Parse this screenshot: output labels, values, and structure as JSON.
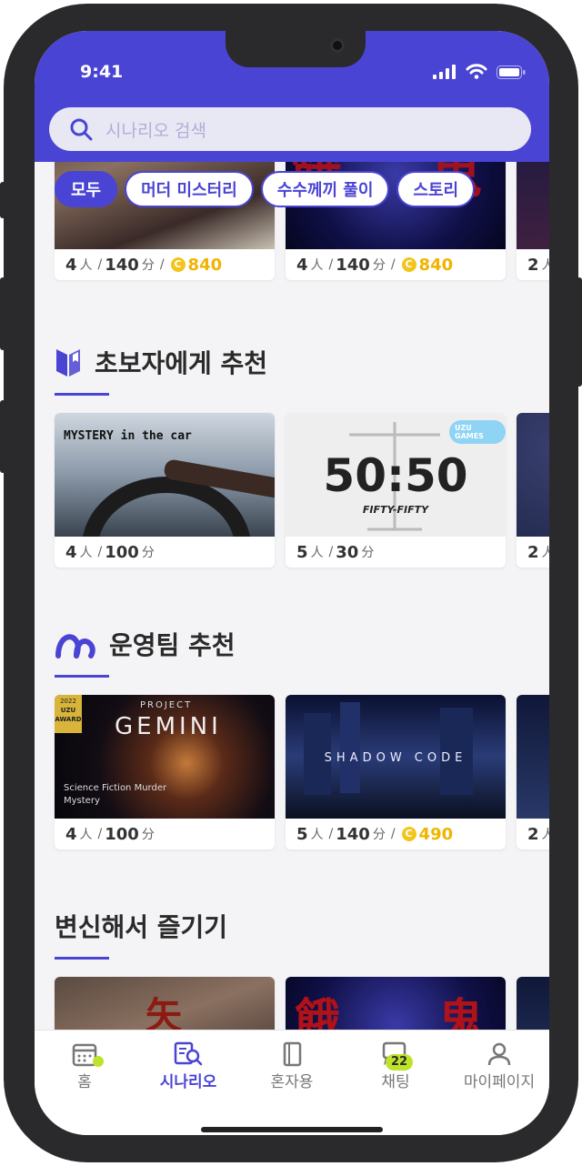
{
  "status_bar": {
    "time": "9:41"
  },
  "search": {
    "placeholder": "시나리오 검색"
  },
  "filters": [
    "모두",
    "머더 미스터리",
    "수수께끼 풀이",
    "스토리"
  ],
  "top_row": [
    {
      "players": "4",
      "players_unit": "人",
      "minutes": "140",
      "minutes_unit": "分",
      "cost": "840"
    },
    {
      "players": "4",
      "players_unit": "人",
      "minutes": "140",
      "minutes_unit": "分",
      "cost": "840"
    },
    {
      "players": "2",
      "players_unit": "人"
    }
  ],
  "sections": [
    {
      "title": "초보자에게 추천",
      "icon": "book-icon",
      "cards": [
        {
          "image_text": "MYSTERY in the car",
          "players": "4",
          "players_unit": "人",
          "minutes": "100",
          "minutes_unit": "分"
        },
        {
          "image_text": "50:50",
          "image_sub": "FIFTY-FIFTY",
          "image_logo": "UZU GAMES",
          "players": "5",
          "players_unit": "人",
          "minutes": "30",
          "minutes_unit": "分"
        },
        {
          "players": "2",
          "players_unit": "人"
        }
      ]
    },
    {
      "title": "운영팀 추천",
      "icon": "uzu-logo-icon",
      "cards": [
        {
          "image_text": "GEMINI",
          "image_pre": "PROJECT",
          "image_sub": "Science Fiction Murder Mystery",
          "image_badge": "UZU AWARD",
          "image_year": "2022",
          "players": "4",
          "players_unit": "人",
          "minutes": "100",
          "minutes_unit": "分"
        },
        {
          "image_text": "SHADOW CODE",
          "players": "5",
          "players_unit": "人",
          "minutes": "140",
          "minutes_unit": "分",
          "cost": "490"
        },
        {
          "players": "2",
          "players_unit": "人"
        }
      ]
    },
    {
      "title": "변신해서 즐기기"
    }
  ],
  "tabs": [
    {
      "label": "홈",
      "icon": "calendar-icon"
    },
    {
      "label": "시나리오",
      "icon": "scenario-search-icon",
      "active": true
    },
    {
      "label": "혼자용",
      "icon": "books-icon"
    },
    {
      "label": "채팅",
      "icon": "chat-icon",
      "badge": "22"
    },
    {
      "label": "마이페이지",
      "icon": "person-icon"
    }
  ],
  "colors": {
    "accent": "#4a44d4",
    "coin": "#f3c41c",
    "badge": "#bde32a"
  }
}
